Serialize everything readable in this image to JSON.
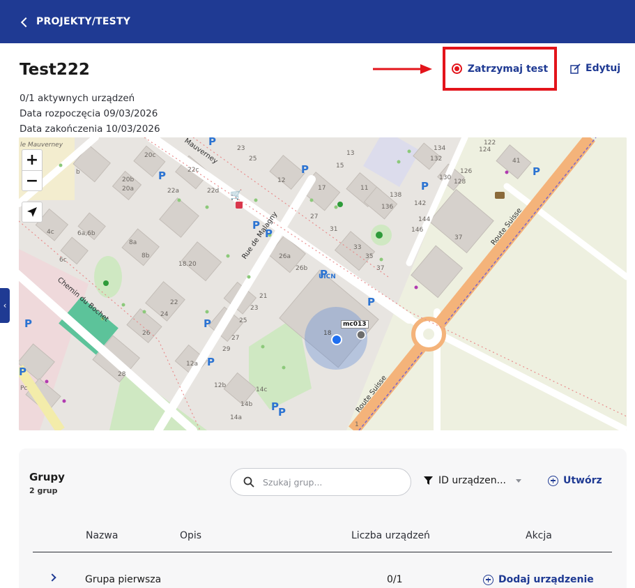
{
  "header": {
    "back_label": "PROJEKTY/TESTY"
  },
  "test": {
    "title": "Test222",
    "active_devices": "0/1 aktywnych urządzeń",
    "start_date": "Data rozpoczęcia 09/03/2026",
    "end_date": "Data zakończenia 10/03/2026"
  },
  "actions": {
    "stop_label": "Zatrzymaj test",
    "edit_label": "Edytuj"
  },
  "colors": {
    "brand": "#1f3a93",
    "highlight": "#e3141b",
    "location_dot": "#1f6ff0"
  },
  "map": {
    "zoom_in": "+",
    "zoom_out": "−",
    "side_toggle": "‹",
    "device_label": "mc013",
    "streets": [
      "le Mauverney",
      "Mauverney",
      "Rue de Malagny",
      "Chemin du Bochet",
      "Route Suisse",
      "Route Suisse"
    ],
    "building_numbers": [
      "20c",
      "20b",
      "20a",
      "22c",
      "22a",
      "22d",
      "23",
      "25",
      "12",
      "13",
      "15",
      "17",
      "11",
      "134",
      "132",
      "130",
      "128",
      "126",
      "122",
      "124",
      "41",
      "138",
      "136",
      "142",
      "144",
      "146",
      "27",
      "31",
      "33",
      "35",
      "37",
      "4c",
      "6a,6b",
      "6c",
      "8a",
      "8b",
      "18.20",
      "26a",
      "26b",
      "21",
      "23",
      "25",
      "27",
      "29",
      "22",
      "24",
      "26",
      "28",
      "12a",
      "12b",
      "14c",
      "14b",
      "14a",
      "b",
      "1"
    ],
    "poi_text": [
      "UICN",
      "18",
      "Pc"
    ]
  },
  "groups": {
    "title": "Grupy",
    "count": "2 grup",
    "search_placeholder": "Szukaj grup...",
    "filter_label": "ID urządzen...",
    "create_label": "Utwórz",
    "columns": [
      "Nazwa",
      "Opis",
      "Liczba urządzeń",
      "Akcja"
    ],
    "rows": [
      {
        "name": "Grupa pierwsza",
        "description": "",
        "devices": "0/1",
        "action": "Dodaj urządzenie"
      }
    ]
  }
}
